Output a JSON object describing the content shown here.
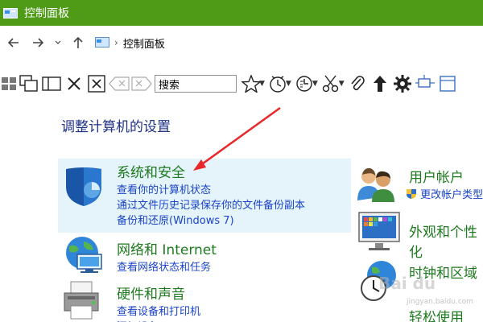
{
  "window": {
    "title": "控制面板"
  },
  "nav": {
    "breadcrumb": "控制面板"
  },
  "toolbar": {
    "search_placeholder": "搜索"
  },
  "main": {
    "heading": "调整计算机的设置",
    "categories_left": [
      {
        "title": "系统和安全",
        "links": [
          "查看你的计算机状态",
          "通过文件历史记录保存你的文件备份副本",
          "备份和还原(Windows 7)"
        ]
      },
      {
        "title": "网络和 Internet",
        "links": [
          "查看网络状态和任务"
        ]
      },
      {
        "title": "硬件和声音",
        "links": [
          "查看设备和打印机"
        ]
      }
    ],
    "categories_right": [
      {
        "title": "用户帐户",
        "links": [
          "更改帐户类型"
        ]
      },
      {
        "title": "外观和个性化",
        "links": []
      },
      {
        "title": "时钟和区域",
        "links": []
      },
      {
        "title": "轻松使用",
        "links": []
      }
    ]
  },
  "colors": {
    "titlebar": "#4f9a17",
    "heading": "#1e3287",
    "category": "#1e7a1e",
    "link": "#1a44c8",
    "highlight": "#e5f3fb",
    "arrow": "#e8282a"
  },
  "watermark": {
    "text": "Bai du",
    "sub": "jingyan.baidu.com"
  }
}
